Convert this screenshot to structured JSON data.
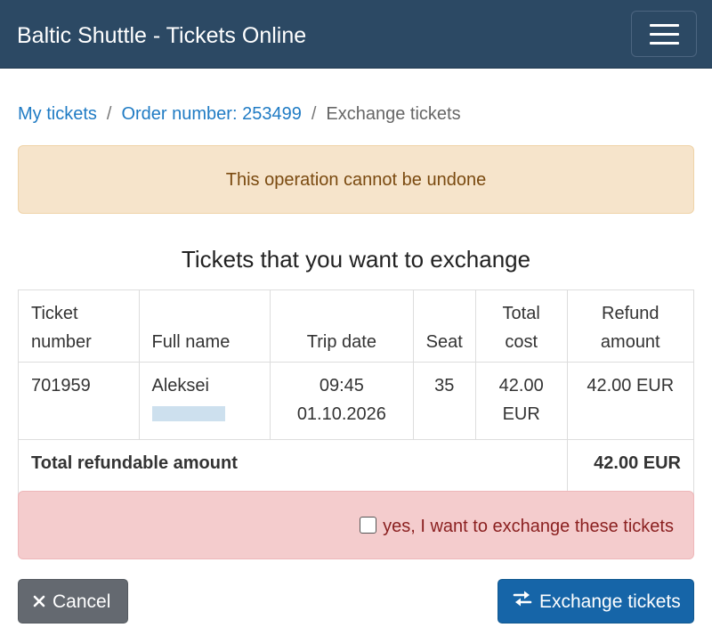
{
  "navbar": {
    "brand": "Baltic Shuttle - Tickets Online",
    "menu_icon": "hamburger-menu-icon"
  },
  "breadcrumb": {
    "my_tickets": "My tickets",
    "order": "Order number: 253499",
    "current": "Exchange tickets",
    "separator": "/"
  },
  "warning": "This operation cannot be undone",
  "section_title": "Tickets that you want to exchange",
  "table": {
    "headers": {
      "ticket_number": "Ticket number",
      "full_name": "Full name",
      "trip_date": "Trip date",
      "seat": "Seat",
      "total_cost": "Total cost",
      "refund_amount": "Refund amount"
    },
    "rows": [
      {
        "ticket_number": "701959",
        "full_name": "Aleksei",
        "trip_time": "09:45",
        "trip_date": "01.10.2026",
        "seat": "35",
        "total_cost": "42.00 EUR",
        "refund_amount": "42.00 EUR"
      }
    ],
    "total_label": "Total refundable amount",
    "total_value": "42.00 EUR"
  },
  "confirm": {
    "label": "yes, I want to exchange these tickets",
    "checked": false
  },
  "buttons": {
    "cancel": "Cancel",
    "cancel_icon": "close-icon",
    "exchange": "Exchange tickets",
    "exchange_icon": "exchange-arrows-icon"
  },
  "colors": {
    "navbar": "#2c4964",
    "link": "#1f7bc4",
    "warning_bg": "#f6e4cb",
    "danger_bg": "#f4cccd",
    "primary": "#1665a8",
    "secondary": "#646970"
  }
}
